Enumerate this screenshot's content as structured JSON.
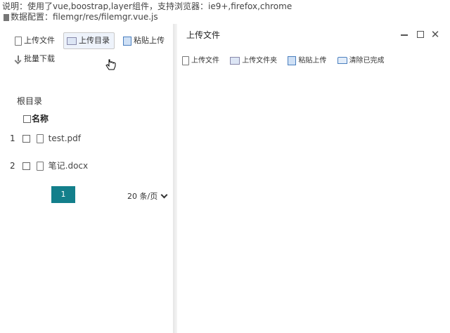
{
  "info": {
    "line1": "说明：使用了vue,boostrap,layer组件，支持浏览器：ie9+,firefox,chrome",
    "line2": "数据配置：filemgr/res/filemgr.vue.js"
  },
  "left_toolbar": {
    "upload_file": "上传文件",
    "upload_folder": "上传目录",
    "paste_upload": "粘贴上传",
    "batch_download": "批量下载"
  },
  "file_panel": {
    "root_label": "根目录",
    "column_name": "名称",
    "rows": [
      {
        "index": "1",
        "name": "test.pdf"
      },
      {
        "index": "2",
        "name": "笔记.docx"
      }
    ]
  },
  "pagination": {
    "current_page": "1",
    "page_size": "20 条/页"
  },
  "upload_window": {
    "title": "上传文件",
    "toolbar": {
      "upload_file": "上传文件",
      "upload_folder": "上传文件夹",
      "paste_upload": "粘贴上传",
      "clear_done": "清除已完成"
    }
  },
  "colors": {
    "accent": "#137f8b"
  }
}
